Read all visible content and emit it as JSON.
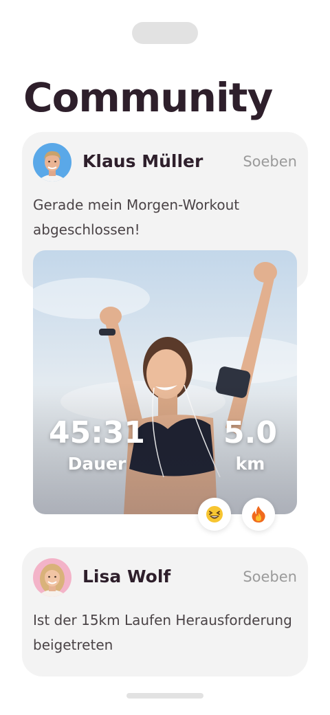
{
  "page": {
    "title": "Community"
  },
  "posts": [
    {
      "author": "Klaus Müller",
      "time": "Soeben",
      "text": "Gerade mein Morgen-Workout abgeschlossen!",
      "avatar_bg": "#5aa8e8",
      "workout": {
        "duration_value": "45:31",
        "duration_label": "Dauer",
        "distance_value": "5.0",
        "distance_label": "km"
      },
      "reactions": [
        {
          "icon": "grinning-squint-emoji-icon"
        },
        {
          "icon": "fire-emoji-icon"
        }
      ]
    },
    {
      "author": "Lisa Wolf",
      "time": "Soeben",
      "text": "Ist der 15km Laufen Herausforderung beigetreten",
      "avatar_bg": "#f3b3c8"
    }
  ],
  "colors": {
    "title": "#2e1f2b",
    "card_bg": "#f3f3f3",
    "muted": "#9a9a9a"
  }
}
